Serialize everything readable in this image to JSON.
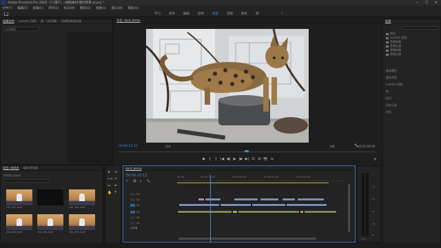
{
  "window": {
    "title": "Adobe Premiere Pro 2020 - C:\\用户\\...\\视频素材\\我的项目.prproj *",
    "controls": [
      "—",
      "☐",
      "✕"
    ]
  },
  "menu": [
    "文件(F)",
    "编辑(E)",
    "剪辑(C)",
    "序列(S)",
    "标记(M)",
    "图形(G)",
    "视图(V)",
    "窗口(W)",
    "帮助(H)"
  ],
  "workspaces": {
    "tabs": [
      "学习",
      "组件",
      "编辑",
      "颜色",
      "效果",
      "音频",
      "图形",
      "库"
    ],
    "active_index": 4,
    "more": "»"
  },
  "source_panel": {
    "tabs": [
      "效果控件",
      "Lumetri 范围",
      "源：(无剪辑)",
      "音频剪辑混合器"
    ],
    "active_index": 0,
    "dropdown": "(无剪辑)"
  },
  "program": {
    "tab": "节目: dent_demo",
    "timecode_left": "00:00:23:11",
    "timecode_right": "00:01:09:06",
    "fit": "适合",
    "quality": "完整",
    "transport": [
      "◆",
      "{",
      "}",
      "|◀",
      "◀|",
      "▶",
      "|▶",
      "▶|",
      "⊡",
      "⊟",
      "📷",
      "⇲",
      "+"
    ]
  },
  "effects_panel": {
    "tab": "效果",
    "tree": [
      "预设",
      "Lumetri 预设",
      "音频效果",
      "音频过渡",
      "视频效果",
      "视频过渡"
    ],
    "list": [
      "基本图形",
      "基本声音",
      "Lumetri 颜色",
      "库",
      "标记",
      "历史记录",
      "信息"
    ]
  },
  "project_panel": {
    "tabs": [
      "项目: 未命名",
      "媒体浏览器"
    ],
    "project_file": "未命名.prproj",
    "clips": [
      "clip_001.mp4",
      "",
      "clip_002.mp4",
      "clip_003.mp4",
      "clip_004.mp4",
      "clip_005.mp4"
    ]
  },
  "timeline": {
    "tab": "dent_demo",
    "timecode": "00:00:23:11",
    "ruler": [
      "00:00",
      "00:00:15:00",
      "00:00:30:00",
      "00:00:45:00",
      "00:01:00:00"
    ],
    "tracks": [
      "V3",
      "V2",
      "V1",
      "A1",
      "A2",
      "A3",
      "主声道"
    ]
  },
  "meters": {
    "scale": [
      "0",
      "-12",
      "-24",
      "-36",
      "-48",
      "dB"
    ],
    "footer": "S S"
  },
  "colors": {
    "accent": "#3d8ee6",
    "video_clip": "#7c8fb7",
    "audio_clip": "#7f8a57",
    "panel_bg": "#232323"
  }
}
